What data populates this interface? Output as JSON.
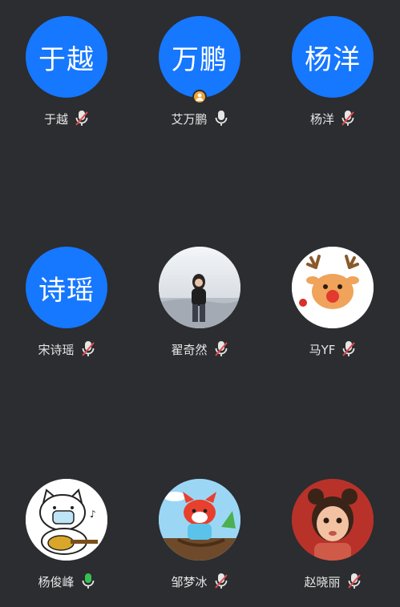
{
  "colors": {
    "background": "#2b2d30",
    "avatar_blue": "#1677ff",
    "text": "#e6e6e6",
    "muted_slash": "#e04b4b",
    "mic_on_green": "#35c152",
    "host_badge": "#f0a537"
  },
  "participants": [
    {
      "avatar_text": "于越",
      "name": "于越",
      "mic": "muted",
      "avatar_type": "text"
    },
    {
      "avatar_text": "万鹏",
      "name": "艾万鹏",
      "mic": "on",
      "avatar_type": "text",
      "badge": "host-badge"
    },
    {
      "avatar_text": "杨洋",
      "name": "杨洋",
      "mic": "muted",
      "avatar_type": "text"
    },
    {
      "avatar_text": "诗瑶",
      "name": "宋诗瑶",
      "mic": "muted",
      "avatar_type": "text"
    },
    {
      "avatar_text": "",
      "name": "翟奇然",
      "mic": "muted",
      "avatar_type": "photo-person"
    },
    {
      "avatar_text": "",
      "name": "马YF",
      "mic": "muted",
      "avatar_type": "reindeer"
    },
    {
      "avatar_text": "",
      "name": "杨俊峰",
      "mic": "active",
      "avatar_type": "cat-guitar"
    },
    {
      "avatar_text": "",
      "name": "邹梦冰",
      "mic": "muted",
      "avatar_type": "fox-cartoon"
    },
    {
      "avatar_text": "",
      "name": "赵晓丽",
      "mic": "muted",
      "avatar_type": "girl-3d"
    }
  ]
}
